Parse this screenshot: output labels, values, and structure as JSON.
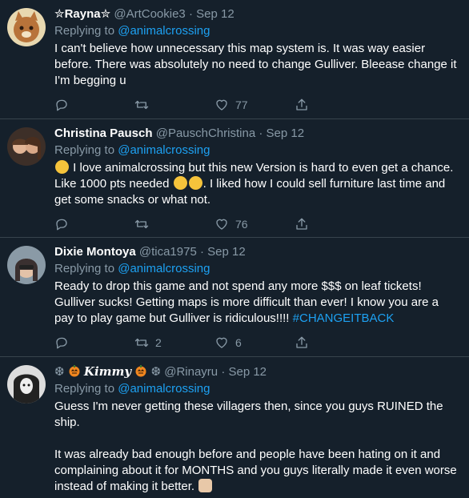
{
  "tweets": [
    {
      "name": "✮Rayna✮",
      "handle": "@ArtCookie3",
      "dot": "·",
      "date": "Sep 12",
      "replying_to_label": "Replying to",
      "replying_to_handle": "@animalcrossing",
      "text": "I can't believe how unnecessary this map system is. It was way easier before. There was absolutely no need to change Gulliver. Bleease change it I'm begging u",
      "reply_count": "",
      "retweet_count": "",
      "like_count": "77",
      "avatar_color": "#b8733a"
    },
    {
      "name": "Christina Pausch",
      "handle": "@PauschChristina",
      "dot": "·",
      "date": "Sep 12",
      "replying_to_label": "Replying to",
      "replying_to_handle": "@animalcrossing",
      "text_a": " I love animalcrossing but this new Version is hard to even get a chance. Like 1000 pts needed ",
      "text_b": ". I liked how I could sell furniture last time and get some snacks or what not.",
      "reply_count": "",
      "retweet_count": "",
      "like_count": "76",
      "avatar_color": "#6b4a36"
    },
    {
      "name": "Dixie Montoya",
      "handle": "@tica1975",
      "dot": "·",
      "date": "Sep 12",
      "replying_to_label": "Replying to",
      "replying_to_handle": "@animalcrossing",
      "text": "Ready to drop this game and not spend any more $$$ on leaf tickets! Gulliver sucks! Getting maps is more difficult than ever! I know you are a pay to play game but Gulliver is ridiculous!!!! ",
      "hashtag": "#CHANGEITBACK",
      "reply_count": "",
      "retweet_count": "2",
      "like_count": "6",
      "avatar_color": "#7a8a96"
    },
    {
      "name": "Kimmy",
      "handle": "@Rinayru",
      "dot": "·",
      "date": "Sep 12",
      "replying_to_label": "Replying to",
      "replying_to_handle": "@animalcrossing",
      "text": "Guess I'm never getting these villagers then, since you guys RUINED the ship.\n\nIt was already bad enough before and people have been hating on it and complaining about it for MONTHS and you guys literally made it even worse instead of making it better. ",
      "avatar_color": "#2b2b2b"
    }
  ],
  "icons": {
    "reply": "reply-icon",
    "retweet": "retweet-icon",
    "like": "heart-icon",
    "share": "share-icon"
  },
  "colors": {
    "background": "#15202b",
    "divider": "#38444d",
    "secondary_text": "#8899a6",
    "accent": "#1da1f2"
  }
}
